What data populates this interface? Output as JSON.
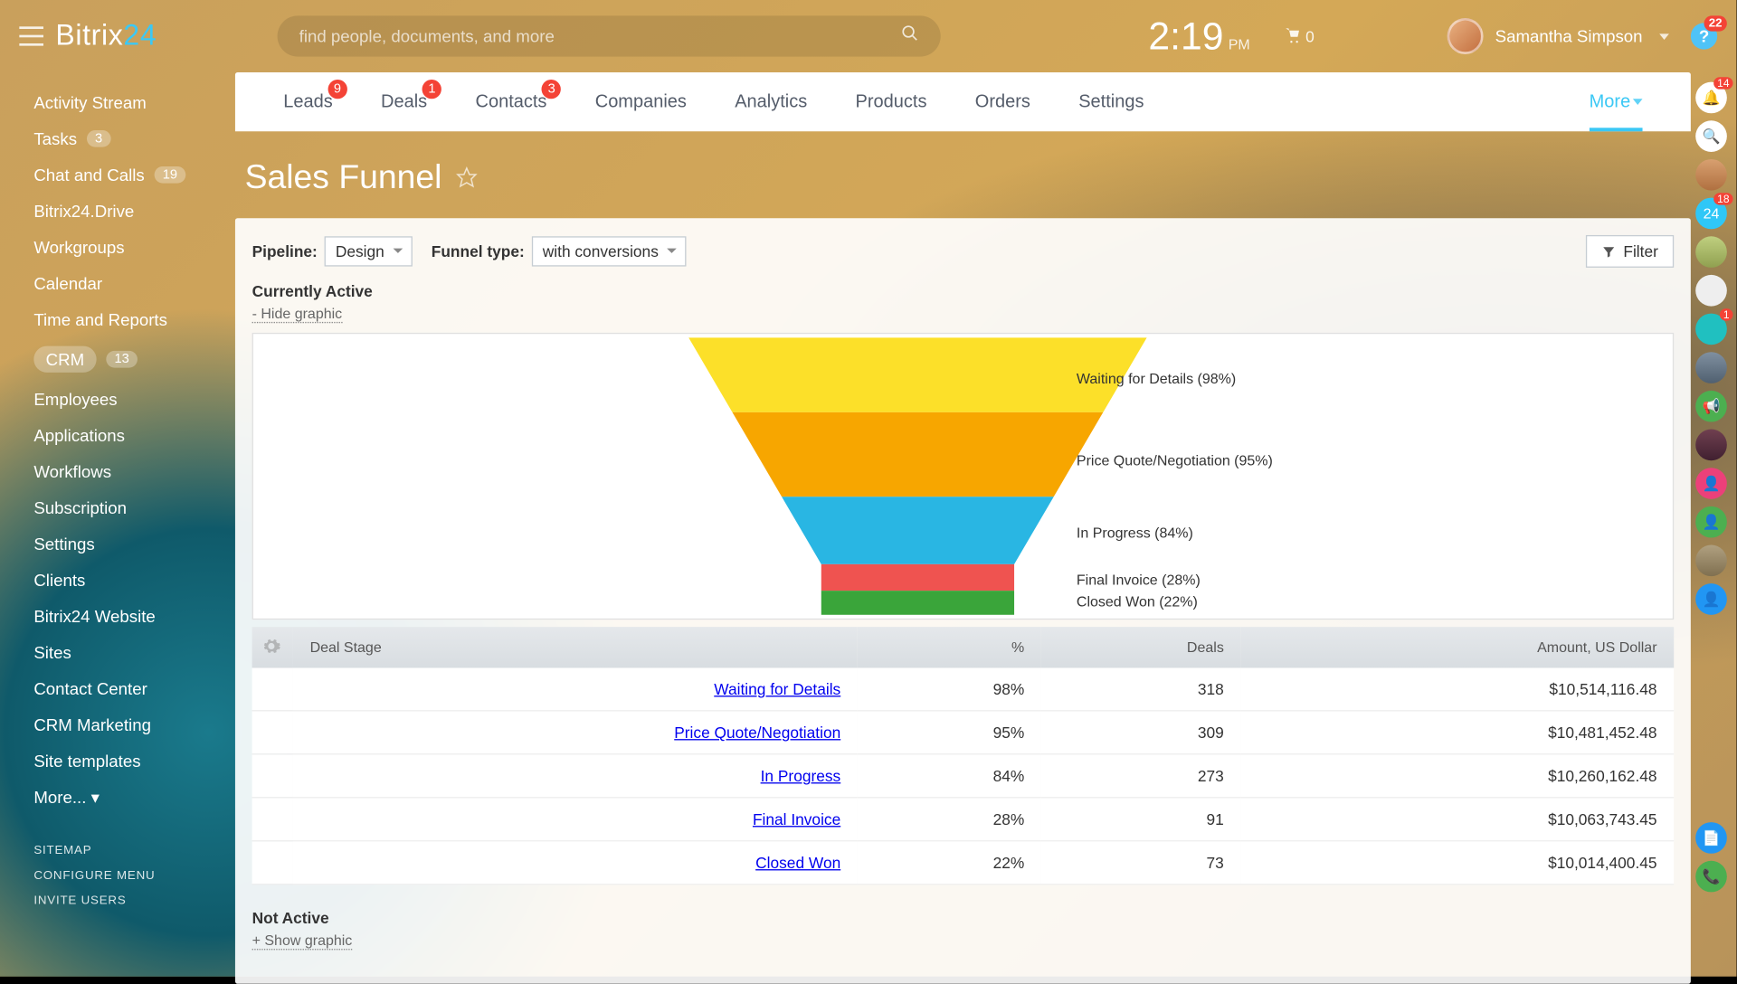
{
  "brand": {
    "a": "Bitrix",
    "b": "24"
  },
  "search": {
    "placeholder": "find people, documents, and more"
  },
  "clock": {
    "time": "2:19",
    "suffix": "PM"
  },
  "cart": {
    "count": "0"
  },
  "user": {
    "name": "Samantha Simpson"
  },
  "help_badge": "22",
  "sidenav": [
    {
      "label": "Activity Stream",
      "badge": null
    },
    {
      "label": "Tasks",
      "badge": "3"
    },
    {
      "label": "Chat and Calls",
      "badge": "19"
    },
    {
      "label": "Bitrix24.Drive",
      "badge": null
    },
    {
      "label": "Workgroups",
      "badge": null
    },
    {
      "label": "Calendar",
      "badge": null
    },
    {
      "label": "Time and Reports",
      "badge": null
    },
    {
      "label": "CRM",
      "badge": "13",
      "active": true
    },
    {
      "label": "Employees",
      "badge": null
    },
    {
      "label": "Applications",
      "badge": null
    },
    {
      "label": "Workflows",
      "badge": null
    },
    {
      "label": "Subscription",
      "badge": null
    },
    {
      "label": "Settings",
      "badge": null
    },
    {
      "label": "Clients",
      "badge": null
    },
    {
      "label": "Bitrix24 Website",
      "badge": null
    },
    {
      "label": "Sites",
      "badge": null
    },
    {
      "label": "Contact Center",
      "badge": null
    },
    {
      "label": "CRM Marketing",
      "badge": null
    },
    {
      "label": "Site templates",
      "badge": null
    },
    {
      "label": "More... ▾",
      "badge": null
    }
  ],
  "sidenav_small": [
    "SITEMAP",
    "CONFIGURE MENU",
    "INVITE USERS"
  ],
  "tabs": [
    {
      "label": "Leads",
      "badge": "9"
    },
    {
      "label": "Deals",
      "badge": "1"
    },
    {
      "label": "Contacts",
      "badge": "3"
    },
    {
      "label": "Companies",
      "badge": null
    },
    {
      "label": "Analytics",
      "badge": null
    },
    {
      "label": "Products",
      "badge": null
    },
    {
      "label": "Orders",
      "badge": null
    },
    {
      "label": "Settings",
      "badge": null
    }
  ],
  "more_tab": "More",
  "page_title": "Sales Funnel",
  "controls": {
    "pipeline_label": "Pipeline:",
    "pipeline_value": "Design",
    "funnel_type_label": "Funnel type:",
    "funnel_type_value": "with conversions",
    "filter": "Filter"
  },
  "section_active": "Currently Active",
  "hide_graphic": "- Hide graphic",
  "section_inactive": "Not Active",
  "show_graphic": "+ Show graphic",
  "table": {
    "cols": [
      "Deal Stage",
      "%",
      "Deals",
      "Amount, US Dollar"
    ]
  },
  "chart_data": {
    "type": "funnel",
    "title": "Sales Funnel – Currently Active",
    "series": [
      {
        "name": "Waiting for Details",
        "pct": 98,
        "deals": 318,
        "amount": "$10,514,116.48",
        "color": "#fce029"
      },
      {
        "name": "Price Quote/Negotiation",
        "pct": 95,
        "deals": 309,
        "amount": "$10,481,452.48",
        "color": "#f7a600"
      },
      {
        "name": "In Progress",
        "pct": 84,
        "deals": 273,
        "amount": "$10,260,162.48",
        "color": "#29b6e3"
      },
      {
        "name": "Final Invoice",
        "pct": 28,
        "deals": 91,
        "amount": "$10,063,743.45",
        "color": "#ef5350"
      },
      {
        "name": "Closed Won",
        "pct": 22,
        "deals": 73,
        "amount": "$10,014,400.45",
        "color": "#3aa53a"
      }
    ]
  },
  "rail_badges": {
    "bell": "14",
    "b24": "18",
    "person": "1"
  }
}
